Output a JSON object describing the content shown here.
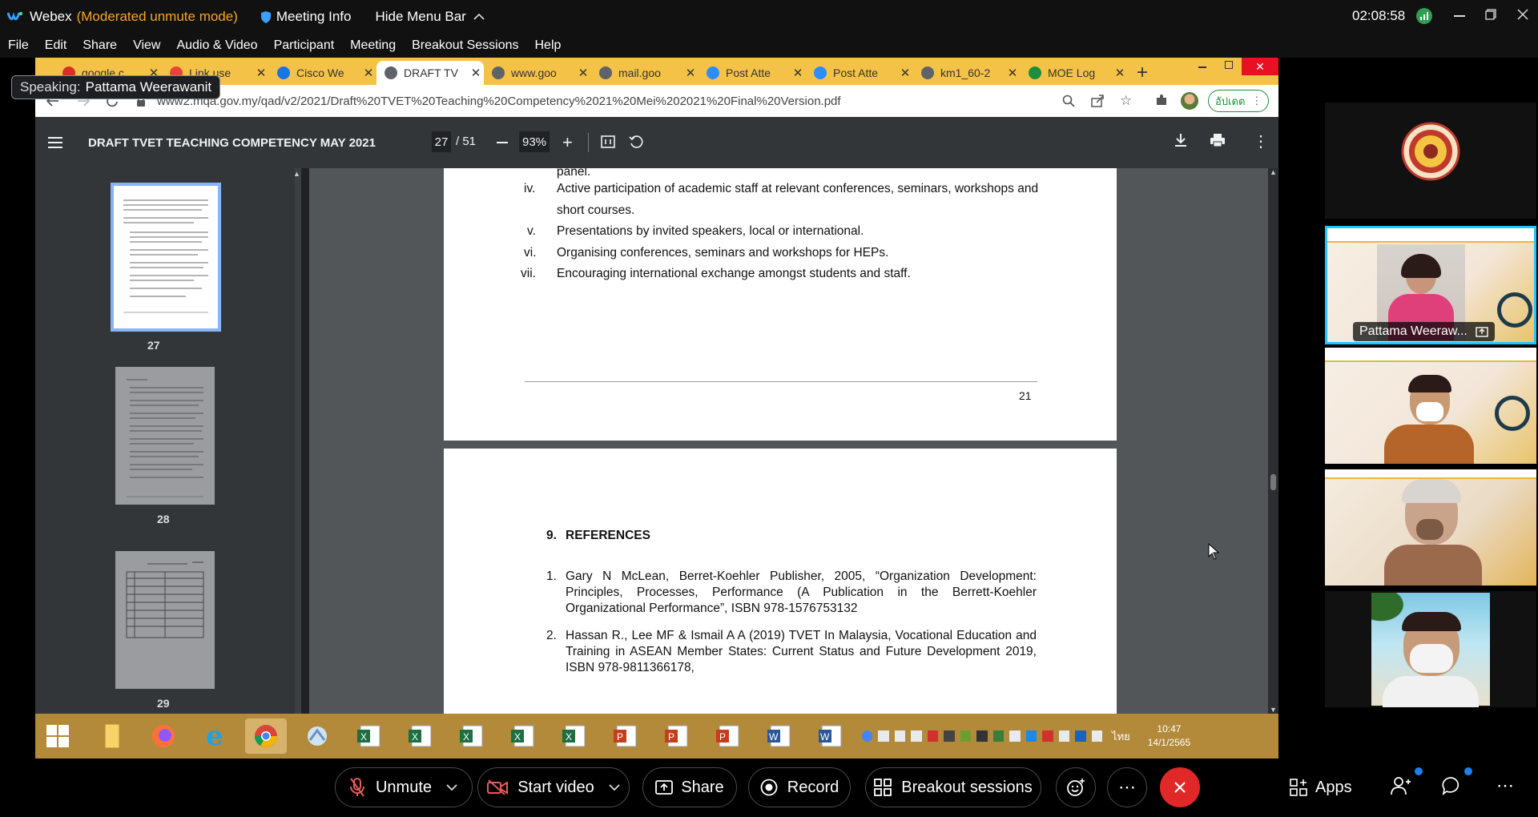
{
  "titlebar": {
    "app_name": "Webex",
    "mode": "(Moderated unmute mode)",
    "meeting_info": "Meeting Info",
    "hide_menu": "Hide Menu Bar",
    "time": "02:08:58"
  },
  "menu": [
    "File",
    "Edit",
    "Share",
    "View",
    "Audio & Video",
    "Participant",
    "Meeting",
    "Breakout Sessions",
    "Help"
  ],
  "speaking": {
    "prefix": "Speaking:",
    "name": "Pattama Weerawanit"
  },
  "browser": {
    "tabs": [
      {
        "label": "google.c",
        "color": "#d93025"
      },
      {
        "label": "Link use",
        "color": "#ea4335"
      },
      {
        "label": "Cisco We",
        "color": "#1a73e8"
      },
      {
        "label": "DRAFT TV",
        "color": "#5f6368"
      },
      {
        "label": "www.goo",
        "color": "#5f6368"
      },
      {
        "label": "mail.goo",
        "color": "#5f6368"
      },
      {
        "label": "Post Atte",
        "color": "#2d8cff"
      },
      {
        "label": "Post Atte",
        "color": "#2d8cff"
      },
      {
        "label": "km1_60-2",
        "color": "#5f6368"
      },
      {
        "label": "MOE Log",
        "color": "#1e8e3e"
      }
    ],
    "url": "www2.mqa.gov.my/qad/v2/2021/Draft%20TVET%20Teaching%20Competency%2021%20Mei%202021%20Final%20Version.pdf",
    "update_label": "อัปเดต"
  },
  "pdf": {
    "title": "DRAFT TVET TEACHING COMPETENCY MAY 2021",
    "page": "27",
    "total": "/ 51",
    "zoom": "93%",
    "thumbs": [
      "27",
      "28",
      "29"
    ]
  },
  "page_top": {
    "cont": "panel.",
    "items": [
      {
        "num": "iv.",
        "lines": [
          "Active participation of academic staff at relevant conferences, seminars, workshops and",
          "short courses."
        ]
      },
      {
        "num": "v.",
        "lines": [
          "Presentations by invited speakers, local or international."
        ]
      },
      {
        "num": "vi.",
        "lines": [
          "Organising conferences, seminars and workshops for HEPs."
        ]
      },
      {
        "num": "vii.",
        "lines": [
          "Encouraging international exchange amongst students and staff."
        ]
      }
    ],
    "page_number": "21"
  },
  "page_refs": {
    "heading_num": "9.",
    "heading": "REFERENCES",
    "refs": [
      {
        "num": "1.",
        "lines": [
          "Gary N McLean, Berret-Koehler Publisher, 2005, “Organization Development:",
          "Principles, Processes, Performance (A Publication in the Berrett-Koehler",
          "Organizational Performance”, ISBN 978-1576753132"
        ]
      },
      {
        "num": "2.",
        "lines": [
          "Hassan R., Lee MF & Ismail A A (2019) TVET In Malaysia, Vocational Education and",
          "Training in ASEAN Member States: Current Status and Future Development 2019,",
          "ISBN 978-9811366178,"
        ]
      }
    ]
  },
  "taskbar": {
    "lang": "ไทย",
    "time": "10:47",
    "date": "14/1/2565"
  },
  "participants": [
    {
      "name": "Pattama Weeraw..."
    }
  ],
  "controls": {
    "unmute": "Unmute",
    "start_video": "Start video",
    "share": "Share",
    "record": "Record",
    "breakout": "Breakout sessions",
    "apps": "Apps"
  },
  "colors": {
    "accent": "#00a0d1",
    "end_call": "#e02828",
    "tab_bar": "#f5c248",
    "taskbar": "#b28a3a"
  }
}
